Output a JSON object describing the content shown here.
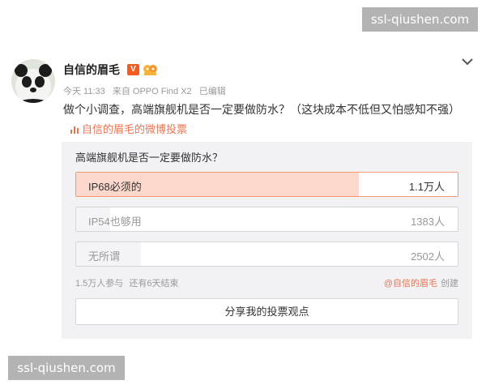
{
  "watermarks": {
    "top": "ssl-qiushen.com",
    "bottom": "ssl-qiushen.com"
  },
  "post": {
    "username": "自信的眉毛",
    "verified_badge": "V",
    "fans_badge_icon": "fans-group-icon",
    "meta": {
      "time": "今天 11:33",
      "source": "来自 OPPO Find X2",
      "edited": "已编辑"
    },
    "text": "做个小调查，高端旗舰机是否一定要做防水？（这块成本不低但又怕感知不强）",
    "vote_link": "自信的眉毛的微博投票"
  },
  "poll": {
    "question": "高端旗舰机是否一定要做防水？",
    "options": [
      {
        "label": "IP68必须的",
        "count": "1.1万人",
        "share": 0.74,
        "selected": true
      },
      {
        "label": "IP54也够用",
        "count": "1383人",
        "share": 0.09,
        "selected": false
      },
      {
        "label": "无所谓",
        "count": "2502人",
        "share": 0.17,
        "selected": false
      }
    ],
    "participants": "1.5万人参与",
    "remaining": "还有6天结束",
    "creator_name": "@自信的眉毛",
    "creator_suffix": "创建",
    "share_button": "分享我的投票观点"
  },
  "colors": {
    "accent": "#eb7350",
    "poll_bg": "#f2f2f5",
    "bar_selected": "#fbd8cb"
  }
}
